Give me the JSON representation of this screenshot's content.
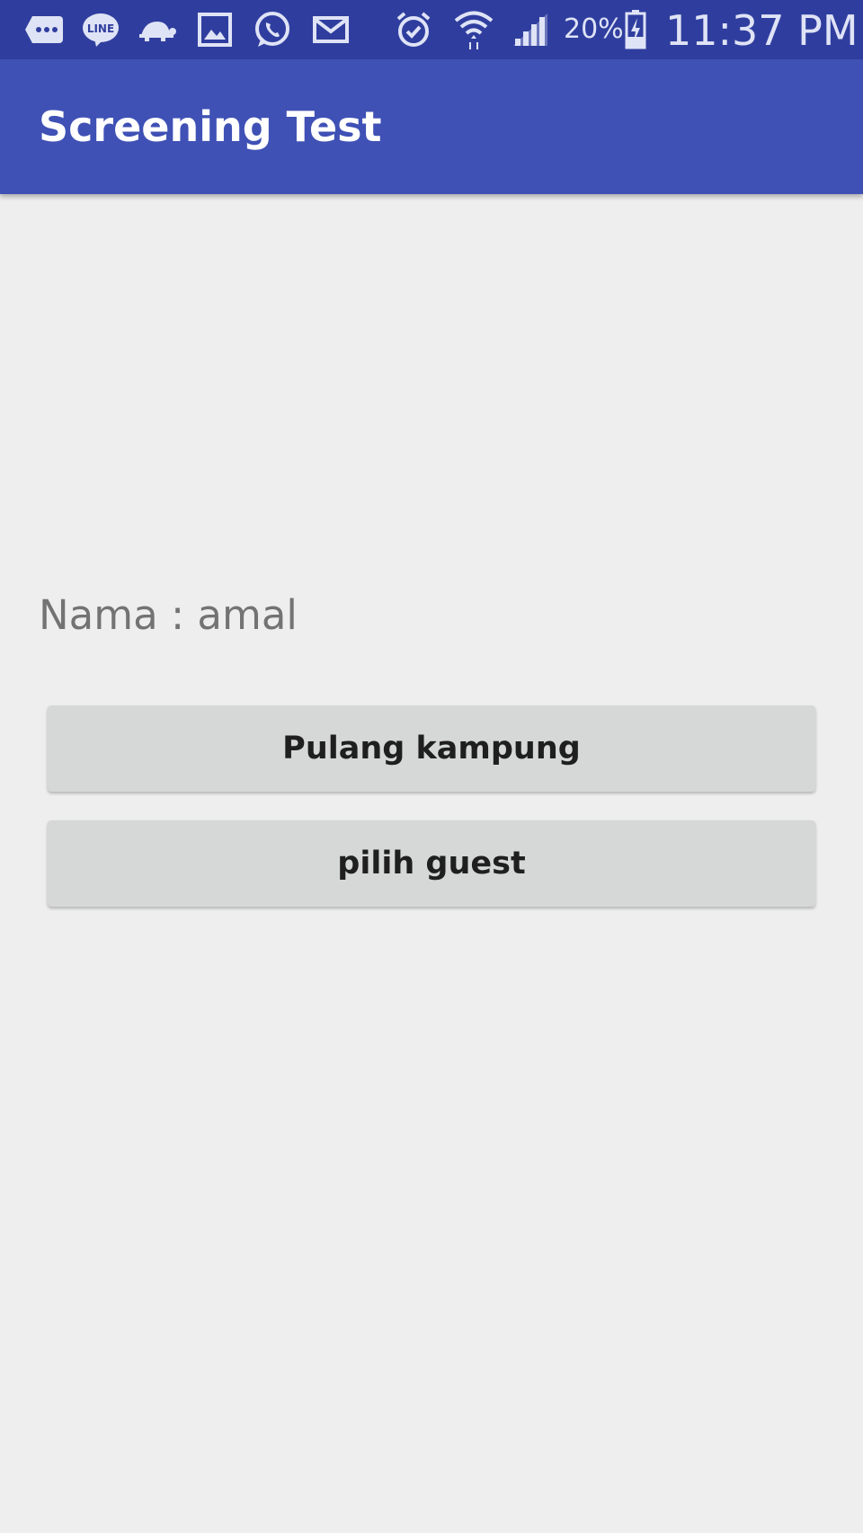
{
  "status_bar": {
    "icons": [
      "messages-icon",
      "line-icon",
      "turtle-icon",
      "gallery-icon",
      "whatsapp-icon",
      "email-icon",
      "alarm-icon",
      "wifi-icon",
      "signal-icon",
      "battery-charging-icon"
    ],
    "battery": "20%",
    "time": "11:37 PM",
    "color": "#2f3e9e"
  },
  "app_bar": {
    "title": "Screening Test",
    "color": "#3f51b5"
  },
  "main": {
    "name_label": "Nama : amal",
    "buttons": [
      {
        "label": "Pulang kampung"
      },
      {
        "label": "pilih guest"
      }
    ]
  }
}
